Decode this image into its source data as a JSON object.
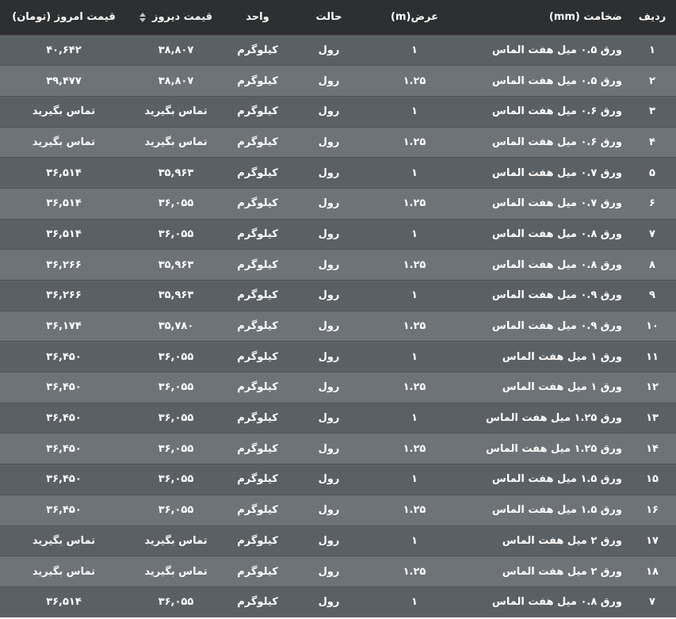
{
  "header": {
    "idx": "ردیف",
    "thickness": "ضخامت (mm)",
    "width": "عرض(m)",
    "state": "حالت",
    "unit": "واحد",
    "prev_price": "قیمت دیروز",
    "today_price": "قیمت امروز (تومان)"
  },
  "rows": [
    {
      "idx": "۱",
      "thickness": "ورق ۰.۵ میل هفت الماس",
      "width": "۱",
      "state": "رول",
      "unit": "کیلوگرم",
      "prev": "۳۸,۸۰۷",
      "today": "۴۰,۶۴۲"
    },
    {
      "idx": "۲",
      "thickness": "ورق ۰.۵ میل هفت الماس",
      "width": "۱.۲۵",
      "state": "رول",
      "unit": "کیلوگرم",
      "prev": "۳۸,۸۰۷",
      "today": "۳۹,۴۷۷"
    },
    {
      "idx": "۳",
      "thickness": "ورق ۰.۶ میل هفت الماس",
      "width": "۱",
      "state": "رول",
      "unit": "کیلوگرم",
      "prev": "تماس بگیرید",
      "today": "تماس بگیرید"
    },
    {
      "idx": "۴",
      "thickness": "ورق ۰.۶ میل هفت الماس",
      "width": "۱.۲۵",
      "state": "رول",
      "unit": "کیلوگرم",
      "prev": "تماس بگیرید",
      "today": "تماس بگیرید"
    },
    {
      "idx": "۵",
      "thickness": "ورق ۰.۷ میل هفت الماس",
      "width": "۱",
      "state": "رول",
      "unit": "کیلوگرم",
      "prev": "۳۵,۹۶۳",
      "today": "۳۶,۵۱۴"
    },
    {
      "idx": "۶",
      "thickness": "ورق ۰.۷ میل هفت الماس",
      "width": "۱.۲۵",
      "state": "رول",
      "unit": "کیلوگرم",
      "prev": "۳۶,۰۵۵",
      "today": "۳۶,۵۱۴"
    },
    {
      "idx": "۷",
      "thickness": "ورق ۰.۸ میل هفت الماس",
      "width": "۱",
      "state": "رول",
      "unit": "کیلوگرم",
      "prev": "۳۶,۰۵۵",
      "today": "۳۶,۵۱۴"
    },
    {
      "idx": "۸",
      "thickness": "ورق ۰.۸ میل هفت الماس",
      "width": "۱.۲۵",
      "state": "رول",
      "unit": "کیلوگرم",
      "prev": "۳۵,۹۶۳",
      "today": "۳۶,۲۶۶"
    },
    {
      "idx": "۹",
      "thickness": "ورق ۰.۹ میل هفت الماس",
      "width": "۱",
      "state": "رول",
      "unit": "کیلوگرم",
      "prev": "۳۵,۹۶۳",
      "today": "۳۶,۲۶۶"
    },
    {
      "idx": "۱۰",
      "thickness": "ورق ۰.۹ میل هفت الماس",
      "width": "۱.۲۵",
      "state": "رول",
      "unit": "کیلوگرم",
      "prev": "۳۵,۷۸۰",
      "today": "۳۶,۱۷۴"
    },
    {
      "idx": "۱۱",
      "thickness": "ورق ۱ میل هفت الماس",
      "width": "۱",
      "state": "رول",
      "unit": "کیلوگرم",
      "prev": "۳۶,۰۵۵",
      "today": "۳۶,۴۵۰"
    },
    {
      "idx": "۱۲",
      "thickness": "ورق ۱ میل هفت الماس",
      "width": "۱.۲۵",
      "state": "رول",
      "unit": "کیلوگرم",
      "prev": "۳۶,۰۵۵",
      "today": "۳۶,۴۵۰"
    },
    {
      "idx": "۱۳",
      "thickness": "ورق ۱.۲۵ میل هفت الماس",
      "width": "۱",
      "state": "رول",
      "unit": "کیلوگرم",
      "prev": "۳۶,۰۵۵",
      "today": "۳۶,۴۵۰"
    },
    {
      "idx": "۱۴",
      "thickness": "ورق ۱.۲۵ میل هفت الماس",
      "width": "۱.۲۵",
      "state": "رول",
      "unit": "کیلوگرم",
      "prev": "۳۶,۰۵۵",
      "today": "۳۶,۴۵۰"
    },
    {
      "idx": "۱۵",
      "thickness": "ورق ۱.۵ میل هفت الماس",
      "width": "۱",
      "state": "رول",
      "unit": "کیلوگرم",
      "prev": "۳۶,۰۵۵",
      "today": "۳۶,۴۵۰"
    },
    {
      "idx": "۱۶",
      "thickness": "ورق ۱.۵ میل هفت الماس",
      "width": "۱.۲۵",
      "state": "رول",
      "unit": "کیلوگرم",
      "prev": "۳۶,۰۵۵",
      "today": "۳۶,۴۵۰"
    },
    {
      "idx": "۱۷",
      "thickness": "ورق ۲ میل هفت الماس",
      "width": "۱",
      "state": "رول",
      "unit": "کیلوگرم",
      "prev": "تماس بگیرید",
      "today": "تماس بگیرید"
    },
    {
      "idx": "۱۸",
      "thickness": "ورق ۲ میل هفت الماس",
      "width": "۱.۲۵",
      "state": "رول",
      "unit": "کیلوگرم",
      "prev": "تماس بگیرید",
      "today": "تماس بگیرید"
    },
    {
      "idx": "۷",
      "thickness": "ورق ۰.۸ میل هفت الماس",
      "width": "۱",
      "state": "رول",
      "unit": "کیلوگرم",
      "prev": "۳۶,۰۵۵",
      "today": "۳۶,۵۱۴"
    }
  ],
  "icons": {
    "sort": "sort-icon"
  },
  "colors": {
    "header_bg": "#2d2f31",
    "row_odd": "#5b6065",
    "row_even": "#6e7378",
    "text": "#ffffff"
  }
}
